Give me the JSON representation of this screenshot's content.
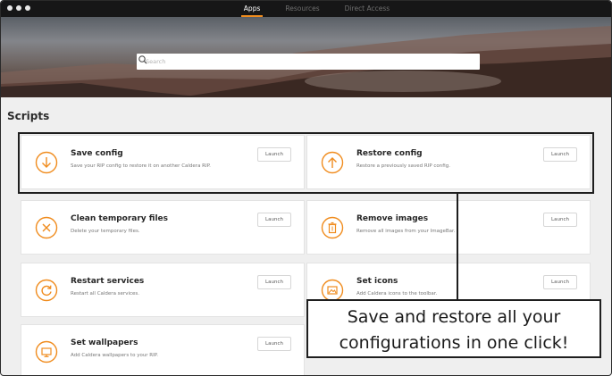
{
  "nav": {
    "tabs": [
      {
        "label": "Apps",
        "active": true
      },
      {
        "label": "Resources",
        "active": false
      },
      {
        "label": "Direct Access",
        "active": false
      }
    ]
  },
  "search": {
    "placeholder": "Search"
  },
  "section": {
    "title": "Scripts"
  },
  "launch_label": "Launch",
  "accent_color": "#f08c1e",
  "cards": [
    {
      "title": "Save config",
      "description": "Save your RIP config to restore it on another Caldera RIP.",
      "icon": "download-icon"
    },
    {
      "title": "Restore config",
      "description": "Restore a previously saved RIP config.",
      "icon": "upload-icon"
    },
    {
      "title": "Clean temporary files",
      "description": "Delete your temporary files.",
      "icon": "close-icon"
    },
    {
      "title": "Remove images",
      "description": "Remove all images from your ImageBar.",
      "icon": "trash-icon"
    },
    {
      "title": "Restart services",
      "description": "Restart all Caldera services.",
      "icon": "refresh-icon"
    },
    {
      "title": "Set icons",
      "description": "Add Caldera icons to the toolbar.",
      "icon": "image-icon"
    },
    {
      "title": "Set wallpapers",
      "description": "Add Caldera wallpapers to your RIP.",
      "icon": "monitor-icon"
    }
  ],
  "callout": {
    "line1": "Save and restore all your",
    "line2": "configurations in one click!"
  }
}
